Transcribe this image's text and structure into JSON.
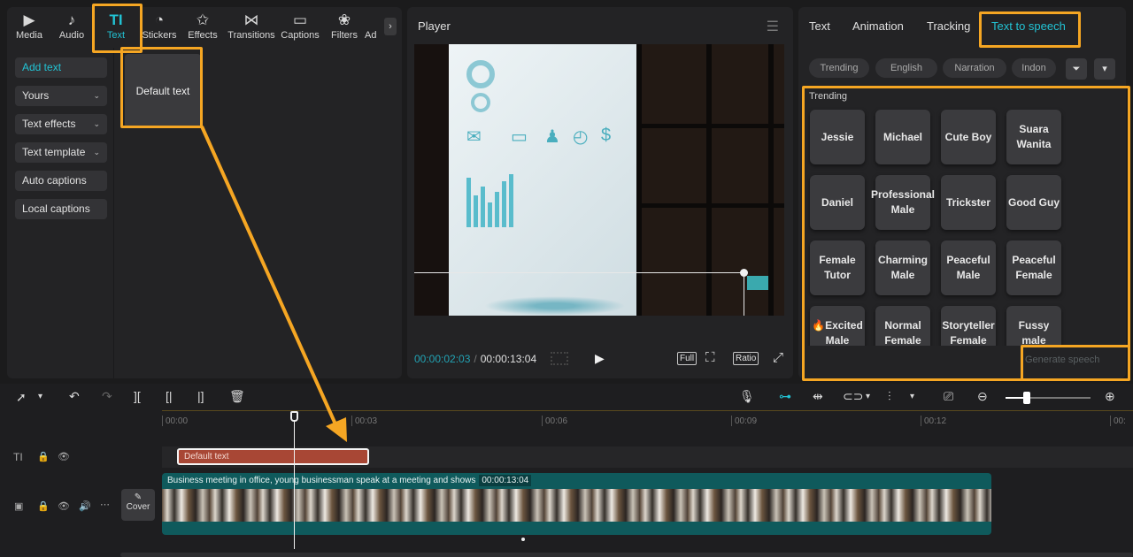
{
  "colors": {
    "accent": "#22c3d4",
    "highlight": "#f5a623",
    "text_clip": "#a84735",
    "video_clip": "#0f5a5c"
  },
  "toolbar": {
    "tabs": [
      {
        "label": "Media",
        "icon": "media-icon"
      },
      {
        "label": "Audio",
        "icon": "audio-icon"
      },
      {
        "label": "Text",
        "icon": "text-icon",
        "active": true
      },
      {
        "label": "Stickers",
        "icon": "sticker-icon"
      },
      {
        "label": "Effects",
        "icon": "effects-icon"
      },
      {
        "label": "Transitions",
        "icon": "transitions-icon"
      },
      {
        "label": "Captions",
        "icon": "captions-icon"
      },
      {
        "label": "Filters",
        "icon": "filters-icon"
      },
      {
        "label": "Ad",
        "icon": "adjust-icon"
      }
    ]
  },
  "text_panel": {
    "side_buttons": [
      {
        "label": "Add text",
        "active": true
      },
      {
        "label": "Yours",
        "dropdown": true
      },
      {
        "label": "Text effects",
        "dropdown": true
      },
      {
        "label": "Text template",
        "dropdown": true
      },
      {
        "label": "Auto captions"
      },
      {
        "label": "Local captions"
      }
    ],
    "default_card": "Default text"
  },
  "player": {
    "title": "Player",
    "current_time": "00:00:02:03",
    "total_time": "00:00:13:04",
    "full_label": "Full",
    "ratio_label": "Ratio"
  },
  "right_panel": {
    "tabs": [
      "Text",
      "Animation",
      "Tracking",
      "Text to speech"
    ],
    "active_tab": "Text to speech",
    "chips": [
      "Trending",
      "English",
      "Narration",
      "Indon"
    ],
    "section": "Trending",
    "voices": [
      [
        "Jessie",
        "Michael",
        "Cute Boy",
        "Suara Wanita"
      ],
      [
        "Daniel",
        "Professional Male",
        "Trickster",
        "Good Guy"
      ],
      [
        "Female Tutor",
        "Charming Male",
        "Peaceful Male",
        "Peaceful Female"
      ],
      [
        "🔥Excited Male",
        "Normal Female",
        "Storyteller Female",
        "Fussy male"
      ]
    ],
    "generate_label": "Generate speech"
  },
  "timeline": {
    "ruler": [
      "00:00",
      "00:03",
      "00:06",
      "00:09",
      "00:12",
      "00:"
    ],
    "text_clip": "Default text",
    "video_clip_title": "Business meeting in office, young businessman speak at a meeting and shows",
    "video_clip_duration": "00:00:13:04",
    "cover_label": "Cover"
  }
}
